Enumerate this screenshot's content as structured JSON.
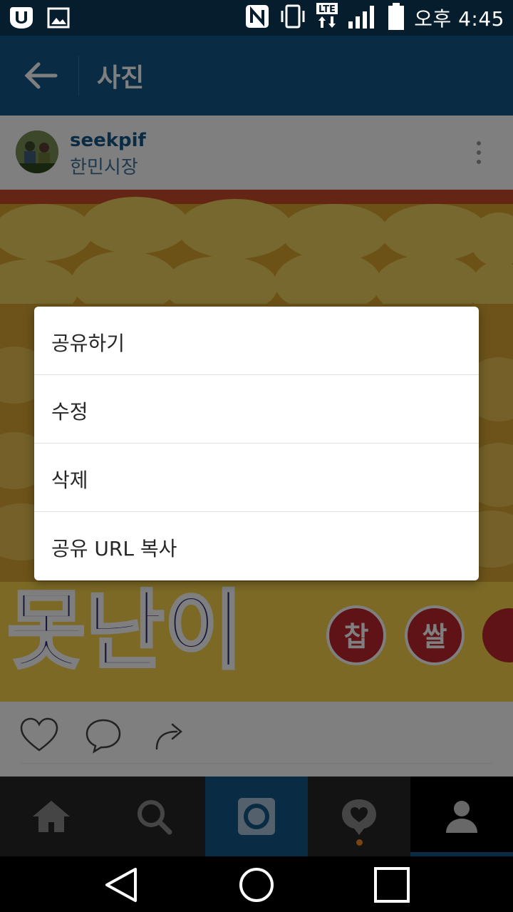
{
  "status_bar": {
    "time": "오후 4:45",
    "icons": [
      "uplus-icon",
      "image-icon",
      "nfc-icon",
      "vibrate-icon",
      "lte-icon",
      "signal-icon",
      "battery-icon"
    ],
    "lte_label": "LTE"
  },
  "app_bar": {
    "title": "사진",
    "back_icon": "arrow-left-icon"
  },
  "post": {
    "username": "seekpif",
    "location": "한민시장",
    "photo_sign_text": "못난이",
    "photo_badge_text": [
      "찹",
      "쌀"
    ]
  },
  "actions": [
    "heart-icon",
    "comment-icon",
    "share-icon"
  ],
  "dialog": {
    "items": [
      {
        "label": "공유하기"
      },
      {
        "label": "수정"
      },
      {
        "label": "삭제"
      },
      {
        "label": "공유 URL 복사"
      }
    ]
  },
  "tabs": [
    {
      "name": "home",
      "icon": "home-icon"
    },
    {
      "name": "search",
      "icon": "search-icon"
    },
    {
      "name": "camera",
      "icon": "camera-icon"
    },
    {
      "name": "activity",
      "icon": "activity-heart-icon"
    },
    {
      "name": "profile",
      "icon": "profile-icon"
    }
  ],
  "colors": {
    "app_bar": "#125688",
    "status_bar": "#061d2e",
    "tab_bar": "#262626",
    "notification_dot": "#f08a24"
  }
}
